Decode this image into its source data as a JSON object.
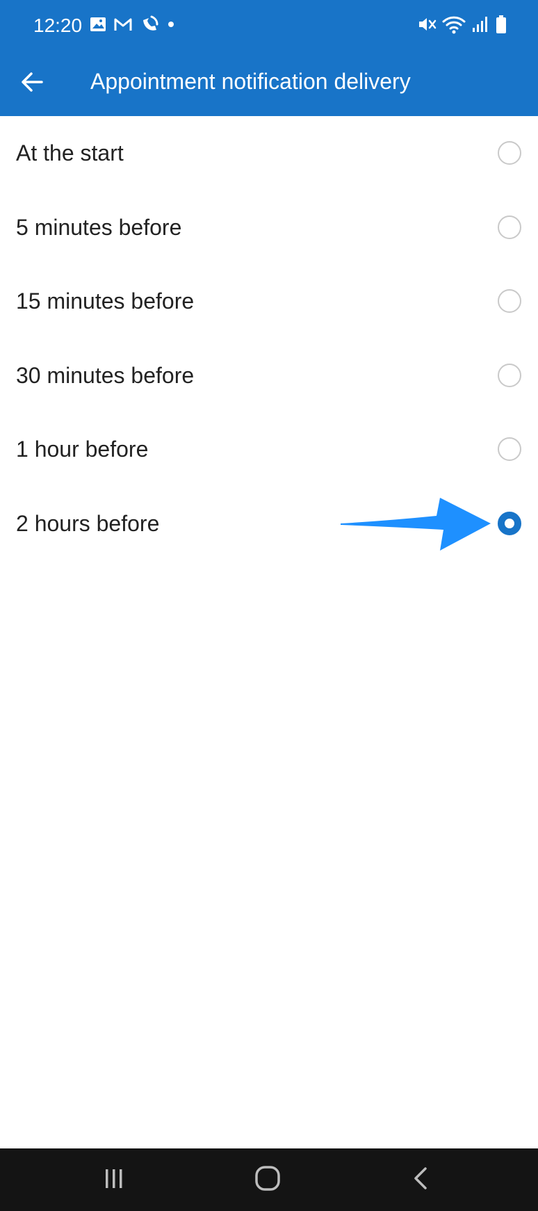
{
  "status_bar": {
    "time": "12:20",
    "left_icons": [
      "image-icon",
      "gmail-icon",
      "phone-app-icon",
      "dot-icon"
    ],
    "right_icons": [
      "vibrate-icon",
      "wifi-icon",
      "signal-icon",
      "battery-icon"
    ]
  },
  "toolbar": {
    "back_icon": "arrow-back-icon",
    "title": "Appointment notification delivery"
  },
  "options": [
    {
      "label": "At the start",
      "selected": false
    },
    {
      "label": "5 minutes before",
      "selected": false
    },
    {
      "label": "15 minutes before",
      "selected": false
    },
    {
      "label": "30 minutes before",
      "selected": false
    },
    {
      "label": "1 hour before",
      "selected": false
    },
    {
      "label": "2 hours before",
      "selected": true
    }
  ],
  "annotation": {
    "icon": "pointer-arrow-icon",
    "color": "#1E90FF"
  },
  "nav_bar": {
    "buttons": [
      "recent-apps-icon",
      "home-icon",
      "back-icon"
    ]
  },
  "colors": {
    "appbar": "#1874C8",
    "accent": "#1874C8",
    "nav_bar": "#141414",
    "text_primary": "#222222",
    "radio_unselected": "#C9C9C9"
  }
}
